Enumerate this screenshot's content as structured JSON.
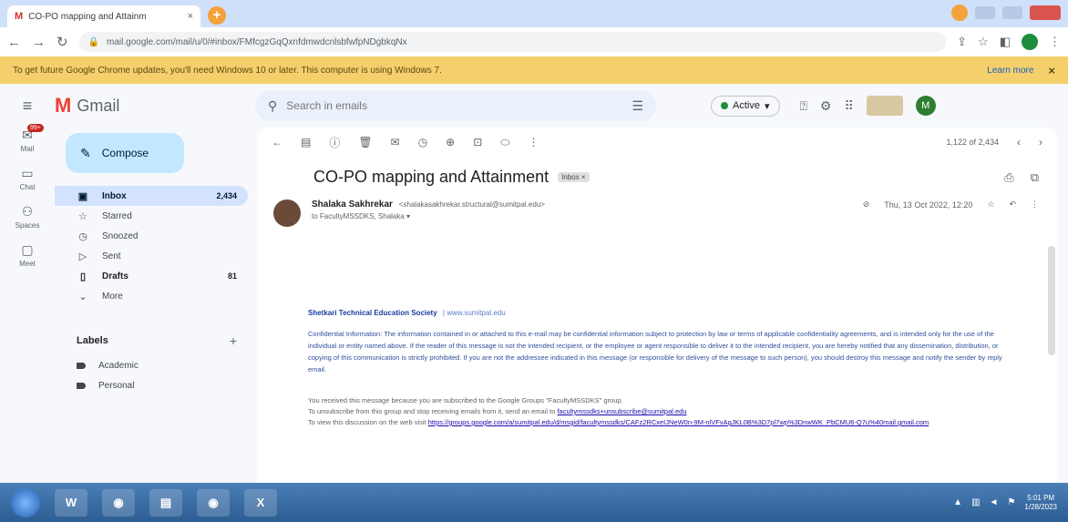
{
  "browser": {
    "tab_title": "CO-PO mapping and Attainm",
    "tab_close": "×",
    "new_tab": "+",
    "url": "mail.google.com/mail/u/0/#inbox/FMfcgzGqQxnfdmwdcnlsbfwfpNDgbkqNx",
    "infobar_message": "To get future Google Chrome updates, you'll need Windows 10 or later. This computer is using Windows 7.",
    "infobar_link": "Learn more",
    "infobar_close": "×"
  },
  "gmail": {
    "logo_word": "Gmail",
    "search_placeholder": "Search in emails",
    "status": "Active",
    "avatar_letter": "M"
  },
  "rail": {
    "mail_label": "Mail",
    "mail_badge": "99+",
    "chat_label": "Chat",
    "spaces_label": "Spaces",
    "meet_label": "Meet"
  },
  "sidebar": {
    "compose": "Compose",
    "items": [
      {
        "label": "Inbox",
        "count": "2,434"
      },
      {
        "label": "Starred",
        "count": ""
      },
      {
        "label": "Snoozed",
        "count": ""
      },
      {
        "label": "Sent",
        "count": ""
      },
      {
        "label": "Drafts",
        "count": "81"
      },
      {
        "label": "More",
        "count": ""
      }
    ],
    "labels_heading": "Labels",
    "labels_add": "+",
    "labels": [
      "Academic",
      "Personal"
    ]
  },
  "message": {
    "pager": "1,122 of 2,434",
    "subject": "CO-PO mapping and Attainment",
    "inbox_chip": "Inbox ×",
    "sender_name": "Shalaka Sakhrekar",
    "sender_email": "<shalakasakhrekar.structural@sumitpal.edu>",
    "to_line": "to FacultyMSSDKS, Shalaka ▾",
    "date": "Thu, 13 Oct 2022, 12:20",
    "org_name": "Shetkari Technical Education Society",
    "org_link": "| www.sumitpal.edu",
    "disclaimer": "Confidential Information: The information contained in or attached to this e-mail may be confidential information subject to protection by law or terms of applicable confidentiality agreements, and is intended only for the use of the individual or entity named above. If the reader of this message is not the intended recipient, or the employee or agent responsible to deliver it to the intended recipient, you are hereby notified that any dissemination, distribution, or copying of this communication is strictly prohibited. If you are not the addressee indicated in this message (or responsible for delivery of the message to such person), you should destroy this message and notify the sender by reply email.",
    "footer_1": "You received this message because you are subscribed to the Google Groups \"FacultyMSSDKS\" group.",
    "footer_2_prefix": "To unsubscribe from this group and stop receiving emails from it, send an email to ",
    "footer_2_link": "facultymssdks+unsubscribe@sumitpal.edu",
    "footer_3_prefix": "To view this discussion on the web visit ",
    "footer_3_link": "https://groups.google.com/a/sumitpal.edu/d/msgid/facultymssdks/CAFz2RCxeIJNeW0n-9M-nlVFvAgJKL0B%3D7pl7wp%3DnwWK_PbCMU6-Q7u%40mail.gmail.com"
  },
  "taskbar": {
    "clock_time": "5:01 PM",
    "clock_date": "1/28/2023"
  }
}
